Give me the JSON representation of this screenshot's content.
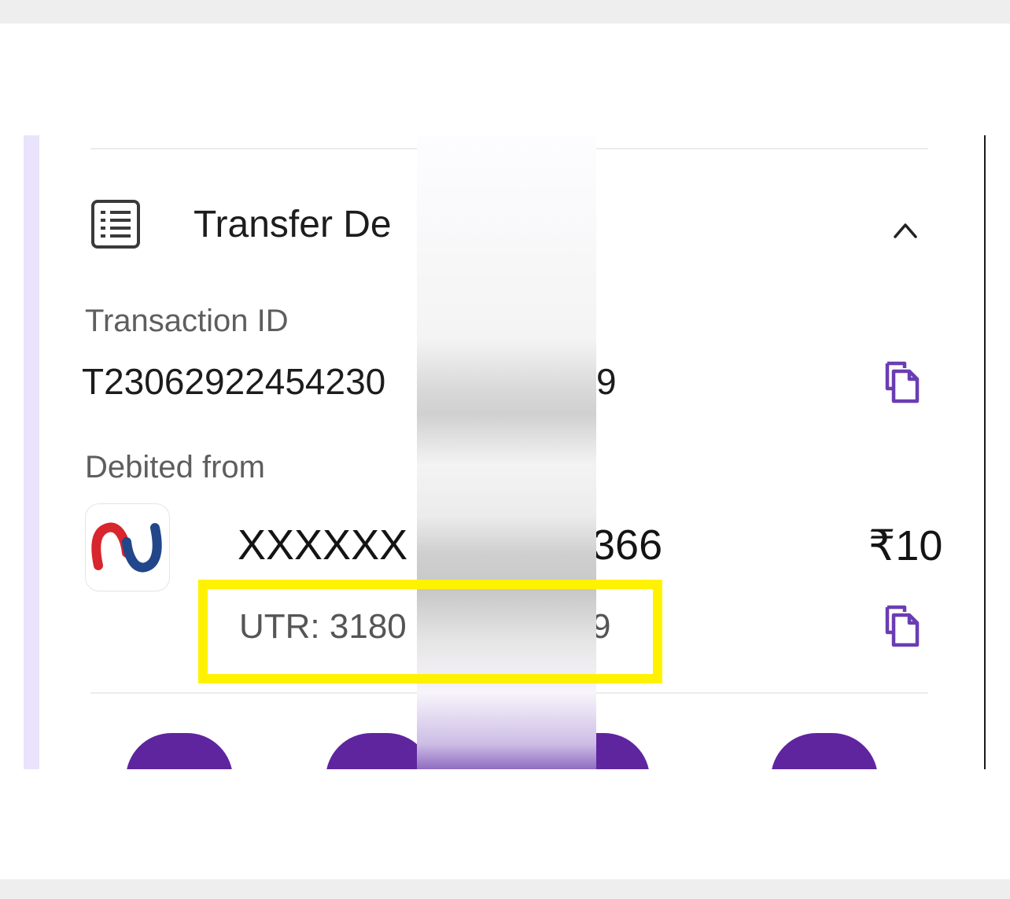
{
  "section": {
    "title": "Transfer De",
    "list_icon": "list-details-icon",
    "collapse_icon": "chevron-up-icon"
  },
  "transaction": {
    "label": "Transaction ID",
    "id_visible_prefix": "T23062922454230",
    "id_visible_suffix": "9",
    "copy_icon": "copy-icon"
  },
  "debit": {
    "label": "Debited from",
    "bank_logo": "union-bank-logo",
    "account_prefix": "XXXXXX",
    "account_suffix": "366",
    "amount": "₹10",
    "utr_prefix": "UTR: 3180",
    "utr_suffix": "9",
    "copy_icon": "copy-icon"
  },
  "colors": {
    "accent": "#5f259f",
    "highlight": "#fff200",
    "side_strip": "#e9e3fb"
  }
}
